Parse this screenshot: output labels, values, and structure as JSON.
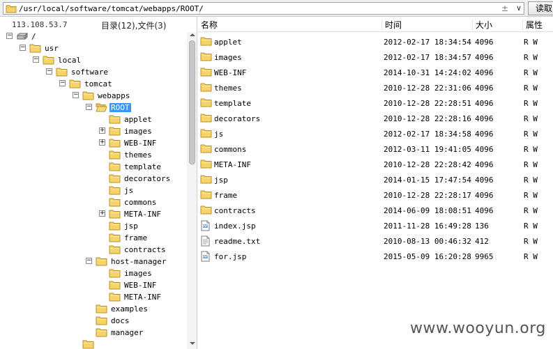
{
  "address_bar": {
    "path": "/usr/local/software/tomcat/webapps/ROOT/",
    "history_symbol": "±",
    "dropdown_symbol": "∨",
    "read_button": "读取"
  },
  "left_panel": {
    "ip": "113.108.53.7",
    "count": "目录(12),文件(3)"
  },
  "tree": [
    {
      "label": "/",
      "depth": 0,
      "expander": "⊟",
      "icon": "drive",
      "selected": false
    },
    {
      "label": "usr",
      "depth": 1,
      "expander": "⊟",
      "icon": "folder",
      "selected": false
    },
    {
      "label": "local",
      "depth": 2,
      "expander": "⊟",
      "icon": "folder",
      "selected": false
    },
    {
      "label": "software",
      "depth": 3,
      "expander": "⊟",
      "icon": "folder",
      "selected": false
    },
    {
      "label": "tomcat",
      "depth": 4,
      "expander": "⊟",
      "icon": "folder",
      "selected": false
    },
    {
      "label": "webapps",
      "depth": 5,
      "expander": "⊟",
      "icon": "folder",
      "selected": false
    },
    {
      "label": "ROOT",
      "depth": 6,
      "expander": "⊟",
      "icon": "folder-open",
      "selected": true
    },
    {
      "label": "applet",
      "depth": 7,
      "expander": "",
      "icon": "folder",
      "selected": false
    },
    {
      "label": "images",
      "depth": 7,
      "expander": "⊞",
      "icon": "folder",
      "selected": false
    },
    {
      "label": "WEB-INF",
      "depth": 7,
      "expander": "⊞",
      "icon": "folder",
      "selected": false
    },
    {
      "label": "themes",
      "depth": 7,
      "expander": "",
      "icon": "folder",
      "selected": false
    },
    {
      "label": "template",
      "depth": 7,
      "expander": "",
      "icon": "folder",
      "selected": false
    },
    {
      "label": "decorators",
      "depth": 7,
      "expander": "",
      "icon": "folder",
      "selected": false
    },
    {
      "label": "js",
      "depth": 7,
      "expander": "",
      "icon": "folder",
      "selected": false
    },
    {
      "label": "commons",
      "depth": 7,
      "expander": "",
      "icon": "folder",
      "selected": false
    },
    {
      "label": "META-INF",
      "depth": 7,
      "expander": "⊞",
      "icon": "folder",
      "selected": false
    },
    {
      "label": "jsp",
      "depth": 7,
      "expander": "",
      "icon": "folder",
      "selected": false
    },
    {
      "label": "frame",
      "depth": 7,
      "expander": "",
      "icon": "folder",
      "selected": false
    },
    {
      "label": "contracts",
      "depth": 7,
      "expander": "",
      "icon": "folder",
      "selected": false
    },
    {
      "label": "host-manager",
      "depth": 6,
      "expander": "⊟",
      "icon": "folder",
      "selected": false
    },
    {
      "label": "images",
      "depth": 7,
      "expander": "",
      "icon": "folder",
      "selected": false
    },
    {
      "label": "WEB-INF",
      "depth": 7,
      "expander": "",
      "icon": "folder",
      "selected": false
    },
    {
      "label": "META-INF",
      "depth": 7,
      "expander": "",
      "icon": "folder",
      "selected": false
    },
    {
      "label": "examples",
      "depth": 6,
      "expander": "",
      "icon": "folder",
      "selected": false
    },
    {
      "label": "docs",
      "depth": 6,
      "expander": "",
      "icon": "folder",
      "selected": false
    },
    {
      "label": "manager",
      "depth": 6,
      "expander": "",
      "icon": "folder",
      "selected": false
    },
    {
      "label": "",
      "depth": 5,
      "expander": "",
      "icon": "folder",
      "selected": false
    }
  ],
  "file_list": {
    "headers": {
      "name": "名称",
      "time": "时间",
      "size": "大小",
      "attr": "属性"
    },
    "rows": [
      {
        "name": "applet",
        "time": "2012-02-17 18:34:54",
        "size": "4096",
        "attr": "R W",
        "type": "folder"
      },
      {
        "name": "images",
        "time": "2012-02-17 18:34:57",
        "size": "4096",
        "attr": "R W",
        "type": "folder"
      },
      {
        "name": "WEB-INF",
        "time": "2014-10-31 14:24:02",
        "size": "4096",
        "attr": "R W",
        "type": "folder"
      },
      {
        "name": "themes",
        "time": "2010-12-28 22:31:06",
        "size": "4096",
        "attr": "R W",
        "type": "folder"
      },
      {
        "name": "template",
        "time": "2010-12-28 22:28:51",
        "size": "4096",
        "attr": "R W",
        "type": "folder"
      },
      {
        "name": "decorators",
        "time": "2010-12-28 22:28:16",
        "size": "4096",
        "attr": "R W",
        "type": "folder"
      },
      {
        "name": "js",
        "time": "2012-02-17 18:34:58",
        "size": "4096",
        "attr": "R W",
        "type": "folder"
      },
      {
        "name": "commons",
        "time": "2012-03-11 19:41:05",
        "size": "4096",
        "attr": "R W",
        "type": "folder"
      },
      {
        "name": "META-INF",
        "time": "2010-12-28 22:28:42",
        "size": "4096",
        "attr": "R W",
        "type": "folder"
      },
      {
        "name": "jsp",
        "time": "2014-01-15 17:47:54",
        "size": "4096",
        "attr": "R W",
        "type": "folder"
      },
      {
        "name": "frame",
        "time": "2010-12-28 22:28:17",
        "size": "4096",
        "attr": "R W",
        "type": "folder"
      },
      {
        "name": "contracts",
        "time": "2014-06-09 18:08:51",
        "size": "4096",
        "attr": "R W",
        "type": "folder"
      },
      {
        "name": "index.jsp",
        "time": "2011-11-28 16:49:28",
        "size": "136",
        "attr": "R W",
        "type": "jsp"
      },
      {
        "name": "readme.txt",
        "time": "2010-08-13 00:46:32",
        "size": "412",
        "attr": "R W",
        "type": "txt"
      },
      {
        "name": "for.jsp",
        "time": "2015-05-09 16:20:28",
        "size": "9965",
        "attr": "R W",
        "type": "jsp"
      }
    ]
  },
  "watermark": "www.wooyun.org",
  "colors": {
    "folder": "#f6d46a",
    "folder_border": "#b8912a",
    "selection": "#3399ff"
  }
}
